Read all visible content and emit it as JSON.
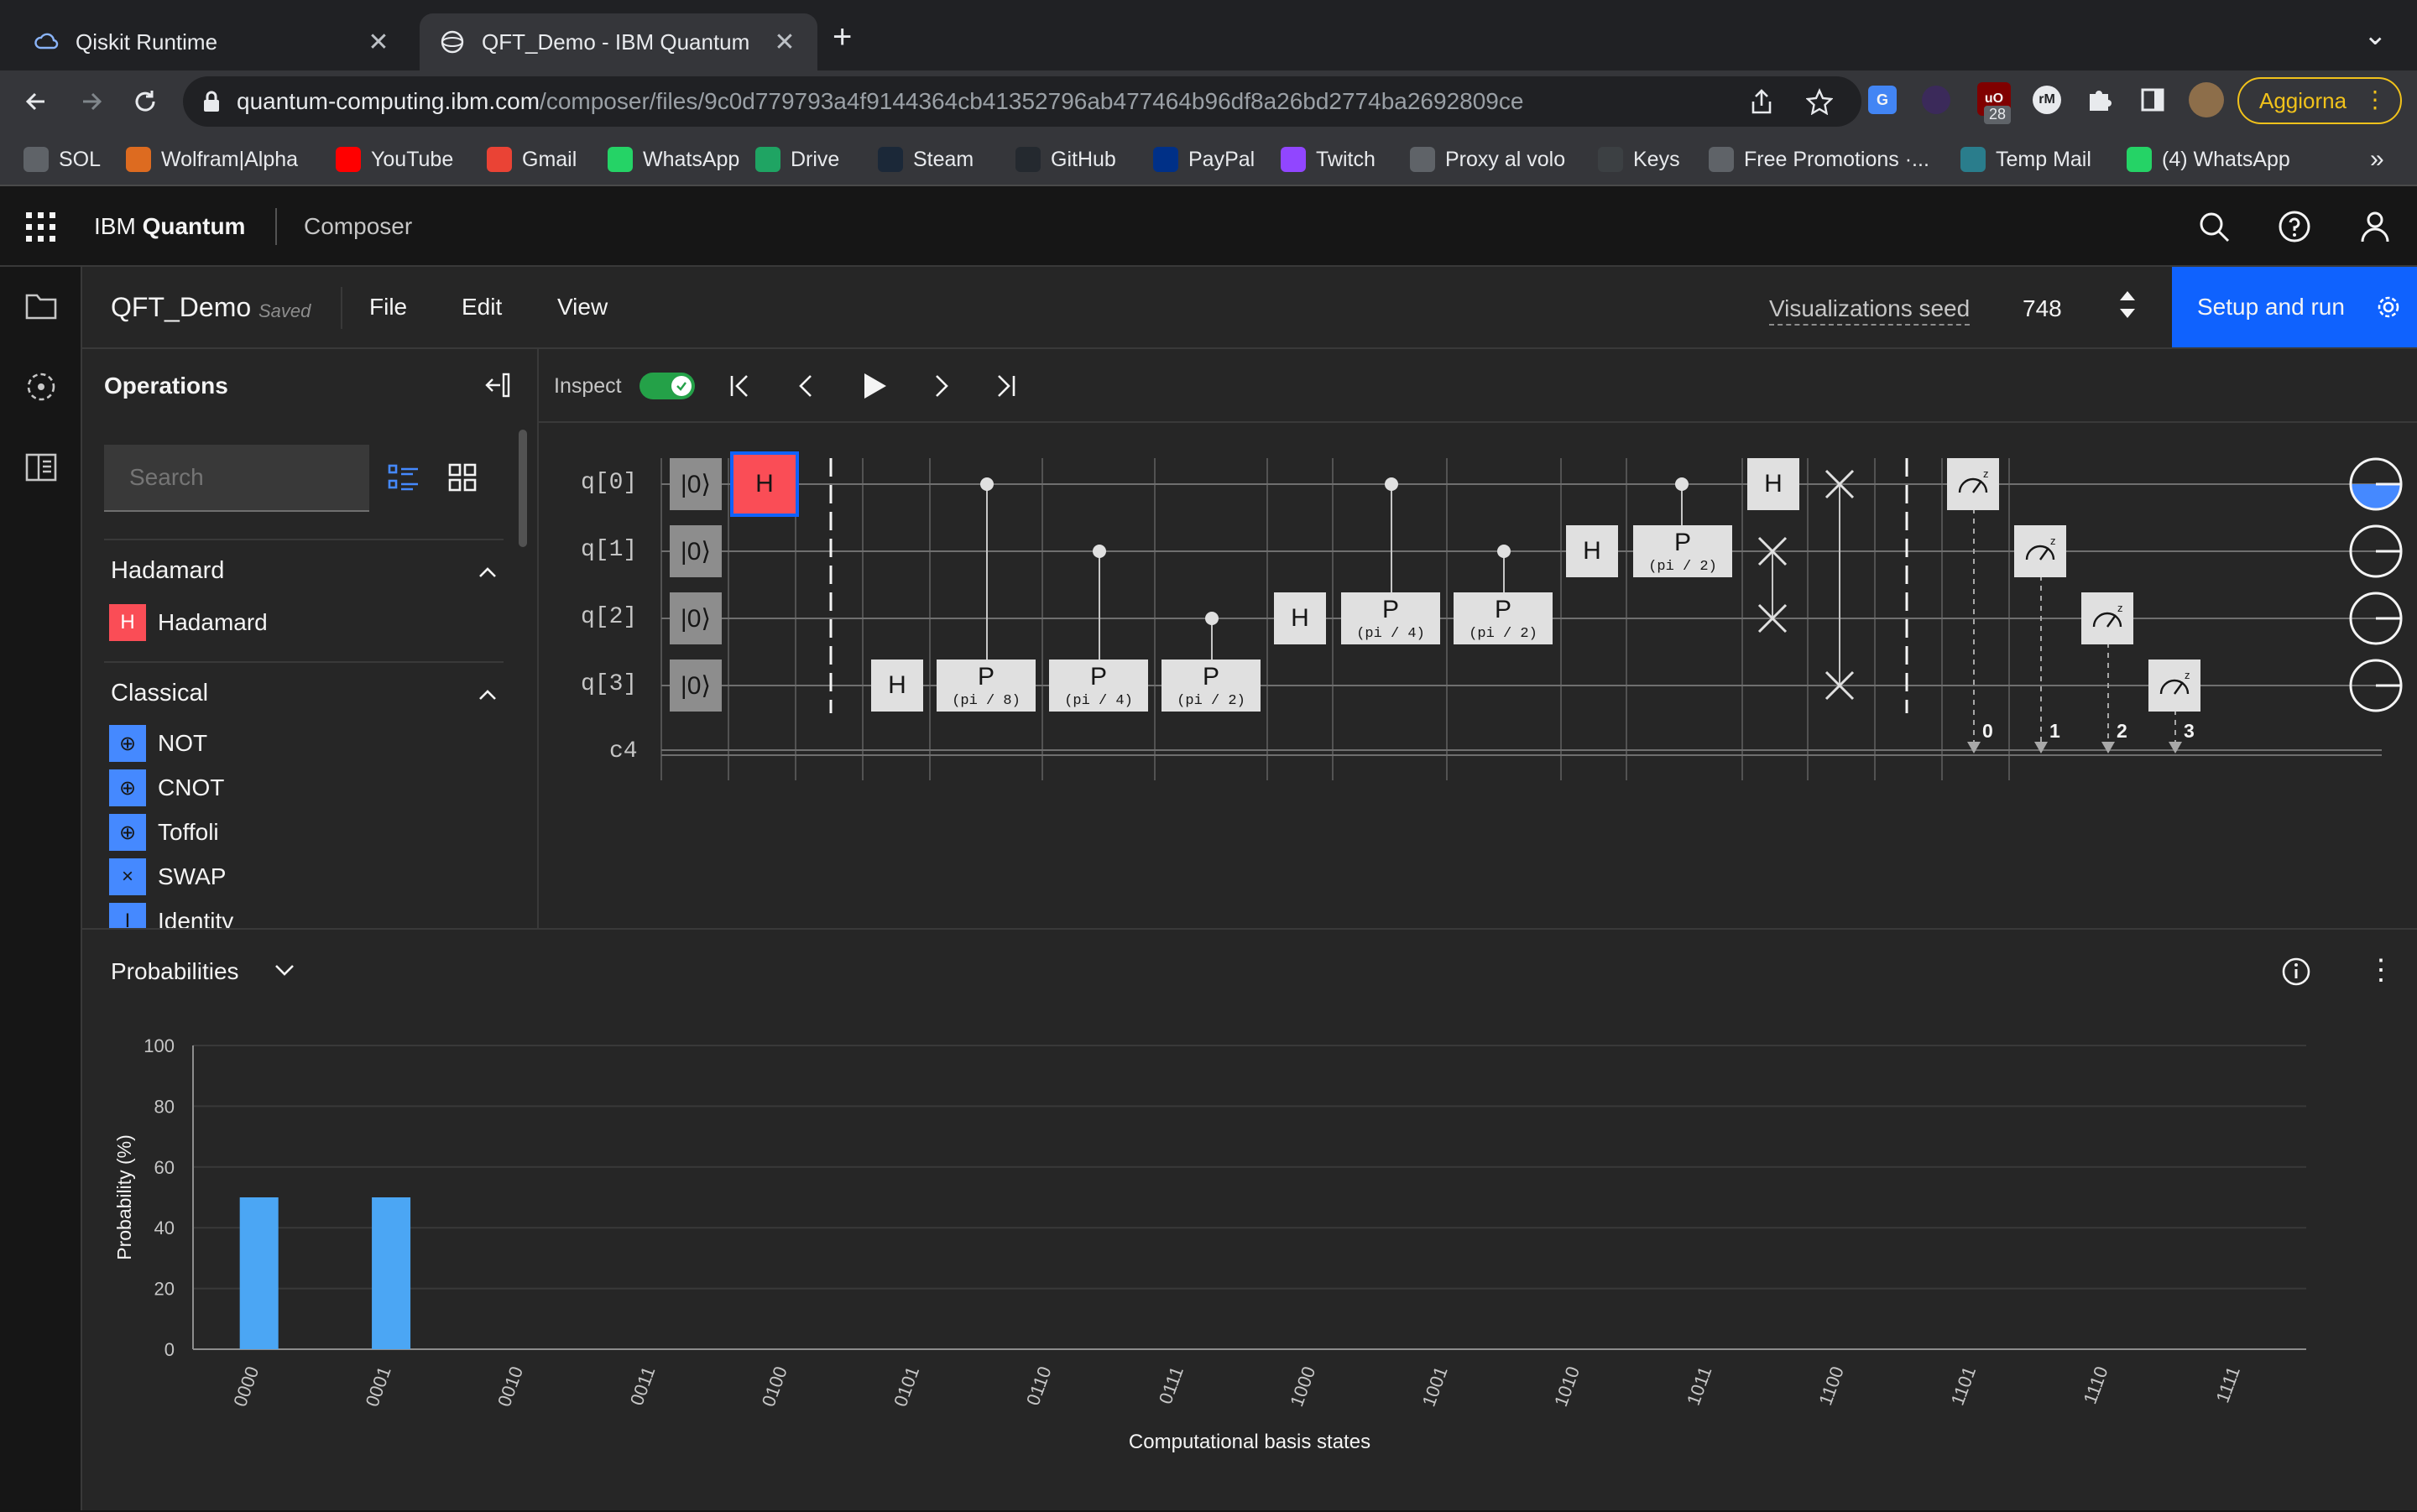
{
  "browser": {
    "tabs": [
      {
        "title": "Qiskit Runtime",
        "icon": "cloud-icon"
      },
      {
        "title": "QFT_Demo - IBM Quantum",
        "icon": "ibm-quantum-icon"
      }
    ],
    "new_tab": "+",
    "tab_menu": "⌄",
    "url_host": "quantum-computing.ibm.com",
    "url_path": "/composer/files/9c0d779793a4f9144364cb41352796ab477464b96df8a26bd2774ba2692809ce",
    "extension_badge": "28",
    "update_button": "Aggiorna",
    "bookmarks": [
      {
        "label": "SOL",
        "color": "#5f6368"
      },
      {
        "label": "Wolfram|Alpha",
        "color": "#dd6b20"
      },
      {
        "label": "YouTube",
        "color": "#ff0000"
      },
      {
        "label": "Gmail",
        "color": "#ea4335"
      },
      {
        "label": "WhatsApp",
        "color": "#25d366"
      },
      {
        "label": "Drive",
        "color": "#1fa463"
      },
      {
        "label": "Steam",
        "color": "#1b2838"
      },
      {
        "label": "GitHub",
        "color": "#24292f"
      },
      {
        "label": "PayPal",
        "color": "#003087"
      },
      {
        "label": "Twitch",
        "color": "#9146ff"
      },
      {
        "label": "Proxy al volo",
        "color": "#5f6368"
      },
      {
        "label": "Keys",
        "color": "#3c4043"
      },
      {
        "label": "Free Promotions ·...",
        "color": "#5f6368"
      },
      {
        "label": "Temp Mail",
        "color": "#2a7d8c"
      },
      {
        "label": "(4) WhatsApp",
        "color": "#25d366"
      }
    ],
    "more_bookmarks": "»"
  },
  "header": {
    "brand_prefix": "IBM ",
    "brand_bold": "Quantum",
    "app": "Composer"
  },
  "subheader": {
    "file_name": "QFT_Demo",
    "save_status": "Saved",
    "menus": [
      "File",
      "Edit",
      "View"
    ],
    "seed_label": "Visualizations seed",
    "seed_value": "748",
    "run_button": "Setup and run"
  },
  "operations": {
    "title": "Operations",
    "search_placeholder": "Search",
    "sections": [
      {
        "title": "Hadamard",
        "items": [
          {
            "label": "Hadamard",
            "glyph": "H",
            "color": "#fa4d56"
          }
        ]
      },
      {
        "title": "Classical",
        "items": [
          {
            "label": "NOT",
            "glyph": "⊕",
            "color": "#4589ff"
          },
          {
            "label": "CNOT",
            "glyph": "⊕",
            "color": "#4589ff"
          },
          {
            "label": "Toffoli",
            "glyph": "⊕",
            "color": "#4589ff"
          },
          {
            "label": "SWAP",
            "glyph": "×",
            "color": "#4589ff"
          },
          {
            "label": "Identity",
            "glyph": "I",
            "color": "#4589ff"
          }
        ]
      }
    ]
  },
  "circuit": {
    "inspect_label": "Inspect",
    "inspect_on": true,
    "qubits": [
      "q[0]",
      "q[1]",
      "q[2]",
      "q[3]"
    ],
    "classical": "c4",
    "init_state": "|0⟩",
    "gate_h": "H",
    "gate_p": "P",
    "params": [
      "(pi / 8)",
      "(pi / 4)",
      "(pi / 2)"
    ],
    "measure_bits": [
      "0",
      "1",
      "2",
      "3"
    ]
  },
  "probabilities": {
    "title": "Probabilities",
    "chart_data": {
      "type": "bar",
      "categories": [
        "0000",
        "0001",
        "0010",
        "0011",
        "0100",
        "0101",
        "0110",
        "0111",
        "1000",
        "1001",
        "1010",
        "1011",
        "1100",
        "1101",
        "1110",
        "1111"
      ],
      "values": [
        50,
        50,
        0,
        0,
        0,
        0,
        0,
        0,
        0,
        0,
        0,
        0,
        0,
        0,
        0,
        0
      ],
      "ylim": [
        0,
        100
      ],
      "yticks": [
        0,
        20,
        40,
        60,
        80,
        100
      ],
      "ylabel": "Probability (%)",
      "xlabel": "Computational basis states",
      "bar_color": "#4ba6f4",
      "grid": true
    }
  },
  "colors": {
    "run_button": "#0f62fe",
    "hadamard": "#fa4d56",
    "selected_outline": "#0f62fe",
    "toggle": "#24a148",
    "update_button_border": "#f1c21b"
  }
}
